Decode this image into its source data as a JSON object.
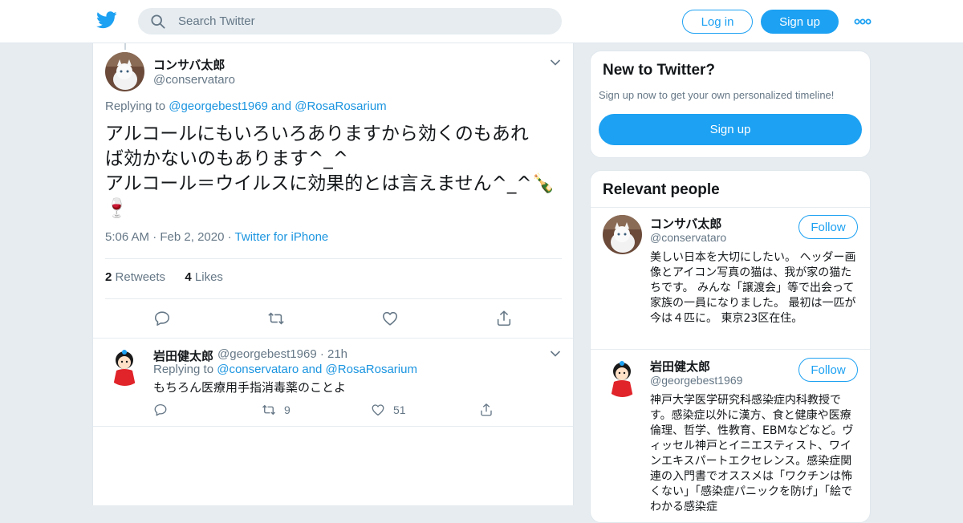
{
  "colors": {
    "accent": "#1da1f2",
    "link": "#1b95e0",
    "muted": "#657786",
    "background": "#e6ecf0"
  },
  "header": {
    "logo_icon": "twitter-bird-icon",
    "search": {
      "placeholder": "Search Twitter",
      "icon": "search-icon"
    },
    "login_label": "Log in",
    "signup_label": "Sign up",
    "more_icon": "more-dots-icon"
  },
  "tweet": {
    "author_name": "コンサバ太郎",
    "author_handle": "@conservataro",
    "replying_prefix": "Replying to",
    "replying_user1": "@georgebest1969",
    "replying_and": "and",
    "replying_user2": "@RosaRosarium",
    "text_line1": "アルコールにもいろいろありますから効くのもあれ",
    "text_line2": "ば効かないのもあります^_^",
    "text_line3": "アルコール＝ウイルスに効果的とは言えません^_^🍾",
    "text_line4": "🍷",
    "time": "5:06 AM",
    "date": "Feb 2, 2020",
    "source": "Twitter for iPhone",
    "retweets_count": "2",
    "retweets_label": "Retweets",
    "likes_count": "4",
    "likes_label": "Likes"
  },
  "reply": {
    "author_name": "岩田健太郎",
    "author_handle": "@georgebest1969",
    "time": "21h",
    "replying_prefix": "Replying to",
    "replying_user1": "@conservataro",
    "replying_and": "and",
    "replying_user2": "@RosaRosarium",
    "text": "もちろん医療用手指消毒薬のことよ",
    "retweet_count": "9",
    "like_count": "51"
  },
  "sidebar": {
    "new_title": "New to Twitter?",
    "new_subtitle": "Sign up now to get your own personalized timeline!",
    "new_signup_label": "Sign up",
    "relevant_title": "Relevant people",
    "people": [
      {
        "name": "コンサバ太郎",
        "handle": "@conservataro",
        "follow_label": "Follow",
        "bio": "美しい日本を大切にしたい。 ヘッダー画像とアイコン写真の猫は、我が家の猫たちです。 みんな「譲渡会」等で出会って家族の一員になりました。 最初は一匹が今は４匹に。 東京23区在住。"
      },
      {
        "name": "岩田健太郎",
        "handle": "@georgebest1969",
        "follow_label": "Follow",
        "bio": "神戸大学医学研究科感染症内科教授です。感染症以外に漢方、食と健康や医療倫理、哲学、性教育、EBMなどなど。ヴィッセル神戸とイニエスティスト、ワインエキスパートエクセレンス。感染症関連の入門書でオススメは「ワクチンは怖くない」「感染症パニックを防げ」「絵でわかる感染症"
      }
    ]
  }
}
